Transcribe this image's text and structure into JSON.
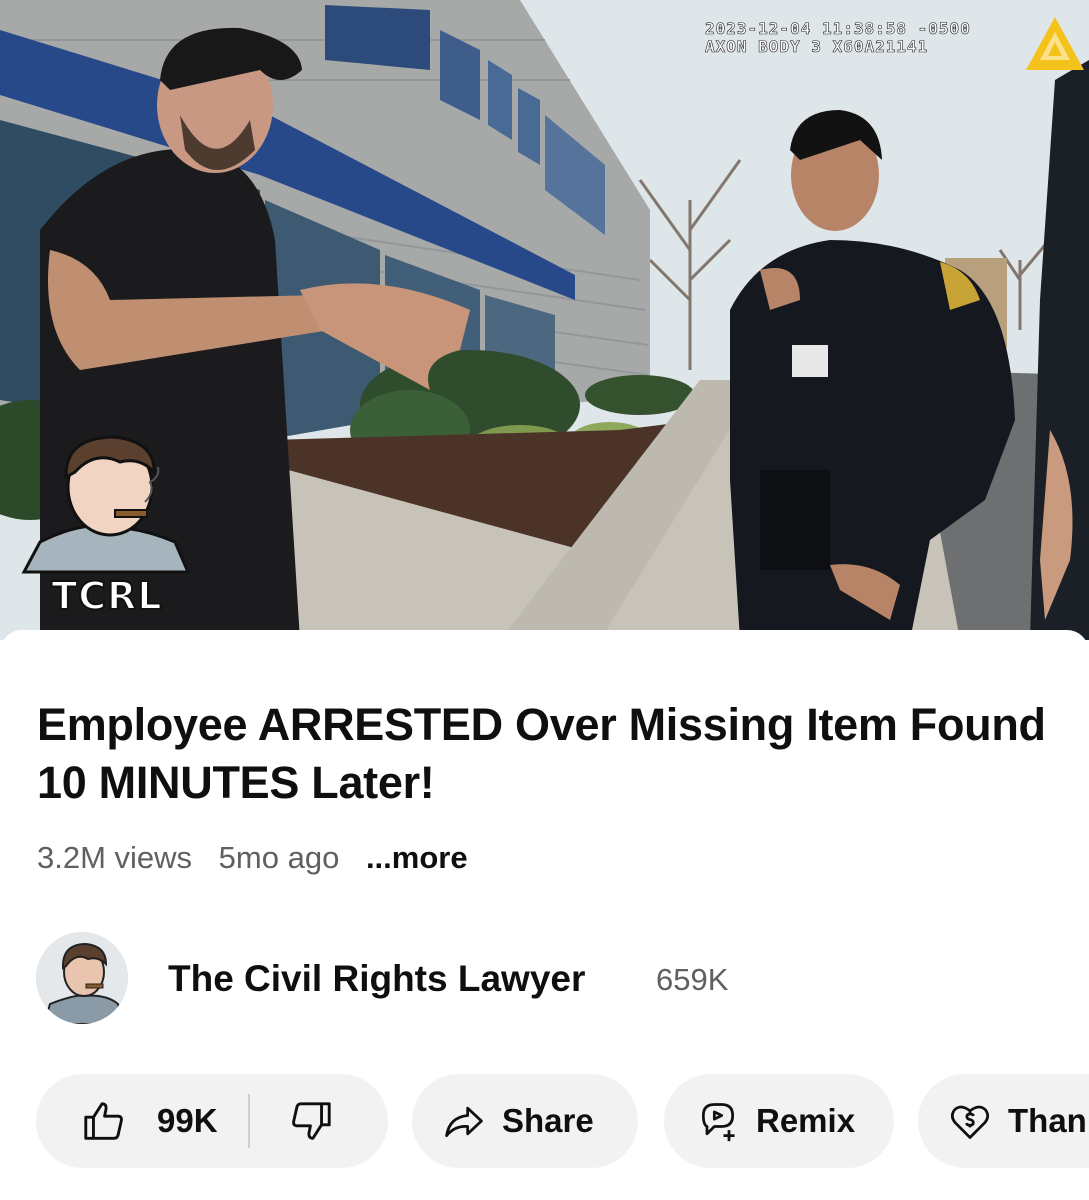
{
  "video": {
    "overlay_line1": "2023-12-04 11:38:58 -0500",
    "overlay_line2": "AXON BODY 3 X60A21141",
    "watermark": "TCRL"
  },
  "title": "Employee ARRESTED Over Missing Item Found 10 MINUTES Later!",
  "meta": {
    "views": "3.2M views",
    "age": "5mo ago",
    "more": "...more"
  },
  "channel": {
    "name": "The Civil Rights Lawyer",
    "subscribers": "659K"
  },
  "actions": {
    "likes": "99K",
    "share": "Share",
    "remix": "Remix",
    "thanks": "Than"
  },
  "colors": {
    "pill_bg": "#f2f2f2",
    "secondary_text": "#606060",
    "primary_text": "#0f0f0f"
  }
}
